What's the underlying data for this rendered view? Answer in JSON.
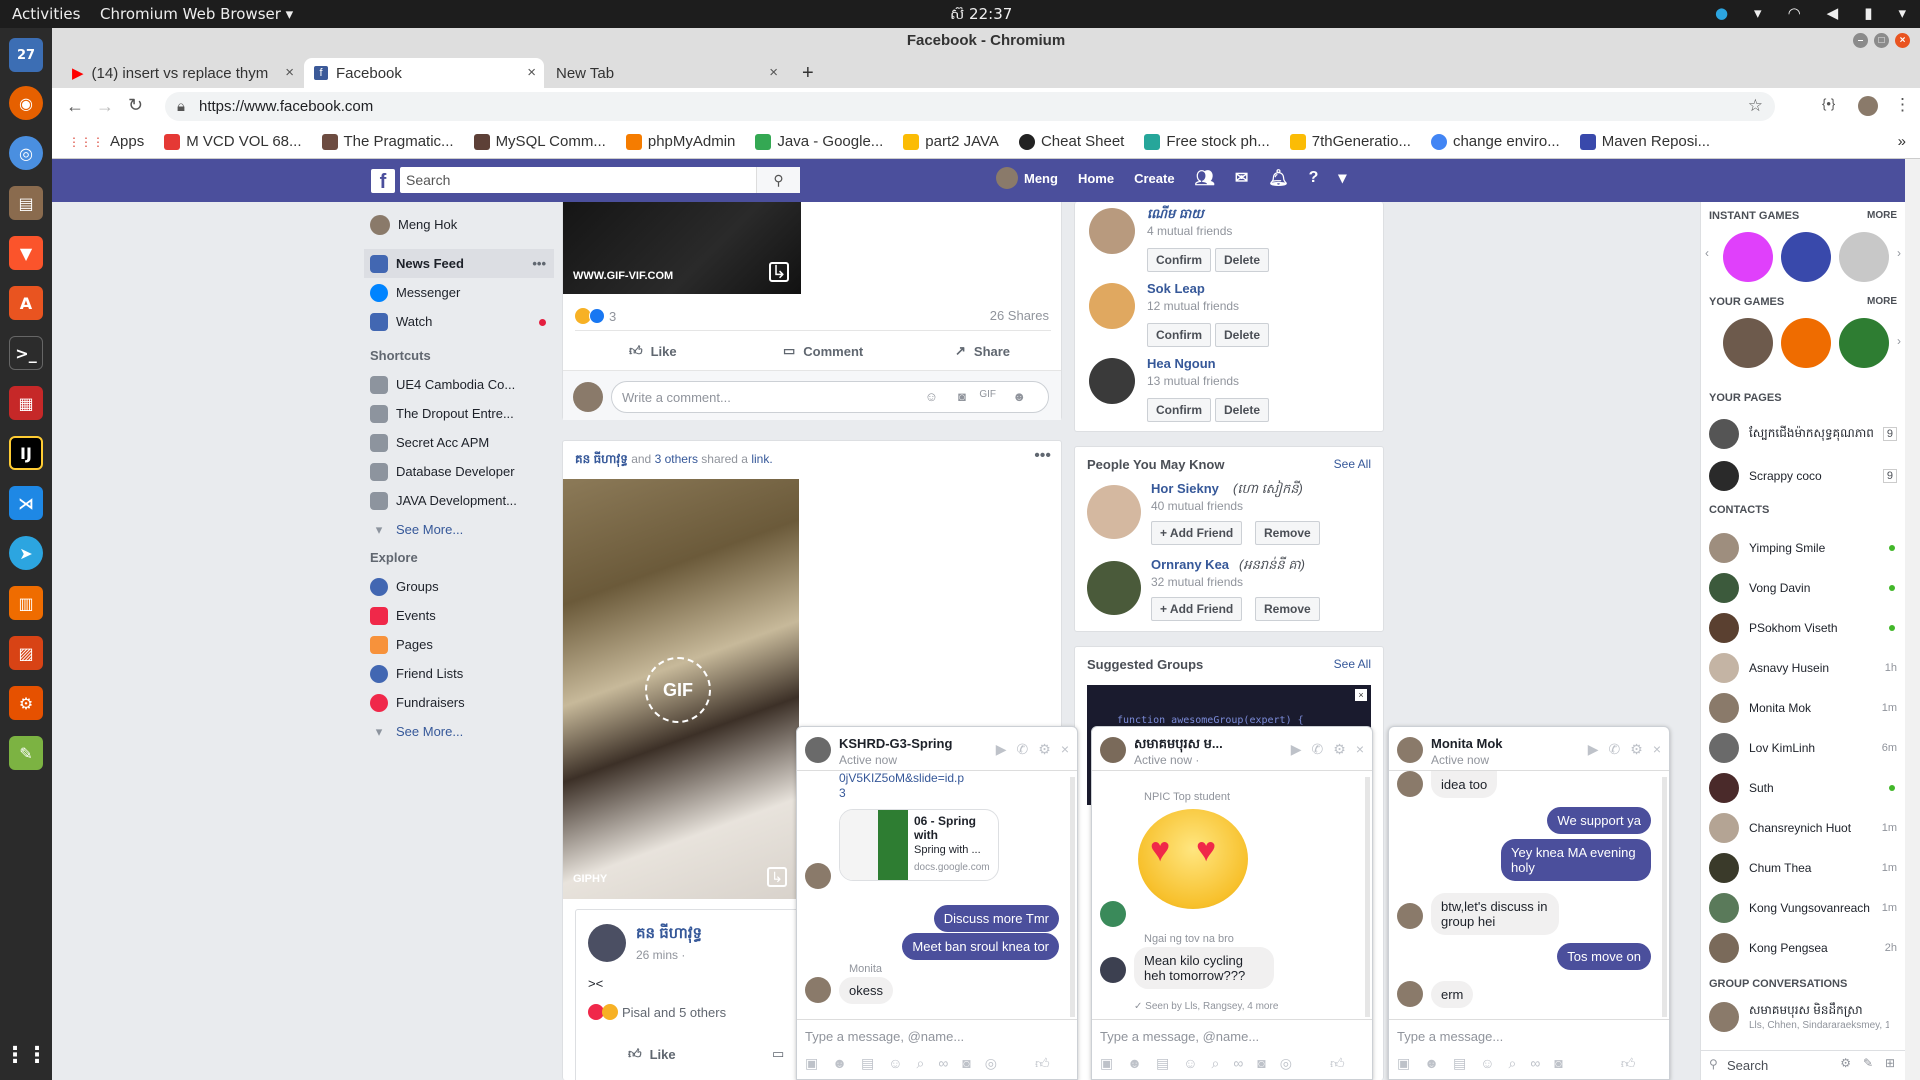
{
  "topbar": {
    "activities": "Activities",
    "app": "Chromium Web Browser ▾",
    "clock": "ស៊ 22:37"
  },
  "dock": {
    "calendar_day": "27"
  },
  "window": {
    "title": "Facebook - Chromium"
  },
  "tabs": [
    {
      "label": "(14) insert vs replace thym",
      "close": "×"
    },
    {
      "label": "Facebook",
      "close": "×"
    },
    {
      "label": "New Tab",
      "close": "×"
    }
  ],
  "new_tab": "+",
  "omnibox": {
    "url": "https://www.facebook.com"
  },
  "bookmarks": [
    {
      "label": "Apps",
      "color": "#db4437"
    },
    {
      "label": "M VCD VOL 68...",
      "color": "#e53935"
    },
    {
      "label": "The Pragmatic...",
      "color": "#6d4c41"
    },
    {
      "label": "MySQL Comm...",
      "color": "#5d4037"
    },
    {
      "label": "phpMyAdmin",
      "color": "#f57c00"
    },
    {
      "label": "Java - Google...",
      "color": "#34a853"
    },
    {
      "label": "part2 JAVA",
      "color": "#fbbc05"
    },
    {
      "label": "Cheat Sheet",
      "color": "#222222"
    },
    {
      "label": "Free stock ph...",
      "color": "#26a69a"
    },
    {
      "label": "7thGeneratio...",
      "color": "#fbbc05"
    },
    {
      "label": "change enviro...",
      "color": "#4285f4"
    },
    {
      "label": "Maven Reposi...",
      "color": "#3949ab"
    }
  ],
  "fb": {
    "logo": "f",
    "search_placeholder": "Search",
    "user": "Meng",
    "home": "Home",
    "create": "Create",
    "brand_color": "#4b4f9c"
  },
  "leftnav": {
    "profile": "Meng Hok",
    "main": [
      {
        "label": "News Feed"
      },
      {
        "label": "Messenger"
      },
      {
        "label": "Watch"
      }
    ],
    "shortcuts_title": "Shortcuts",
    "shortcuts": [
      {
        "label": "UE4 Cambodia Co..."
      },
      {
        "label": "The Dropout Entre..."
      },
      {
        "label": "Secret Acc APM"
      },
      {
        "label": "Database Developer"
      },
      {
        "label": "JAVA Development..."
      }
    ],
    "see_more": "See More...",
    "explore_title": "Explore",
    "explore": [
      {
        "label": "Groups"
      },
      {
        "label": "Events"
      },
      {
        "label": "Pages"
      },
      {
        "label": "Friend Lists"
      },
      {
        "label": "Fundraisers"
      }
    ]
  },
  "post1": {
    "gif_caption": "WWW.GIF-VIF.COM",
    "reactions": "3",
    "shares": "26 Shares",
    "like": "Like",
    "comment": "Comment",
    "share": "Share",
    "comment_placeholder": "Write a comment..."
  },
  "post2": {
    "author": "គន ធីហាវុទ្ធ",
    "and": "and",
    "others": "3 others",
    "shared": "shared a",
    "link": "link.",
    "gif_badge": "GIF",
    "giphy": "GIPHY",
    "inner_author": "គន ធីហាវុទ្ធ",
    "inner_time": "26 mins ·",
    "inner_text": "><",
    "inner_reactions": "Pisal and 5 others",
    "like": "Like"
  },
  "requests": [
    {
      "name": "ណើម ធាយ",
      "mutual": "4 mutual friends",
      "confirm": "Confirm",
      "delete": "Delete"
    },
    {
      "name": "Sok Leap",
      "mutual": "12 mutual friends",
      "confirm": "Confirm",
      "delete": "Delete"
    },
    {
      "name": "Hea Ngoun",
      "mutual": "13 mutual friends",
      "confirm": "Confirm",
      "delete": "Delete"
    }
  ],
  "pymk": {
    "title": "People You May Know",
    "see_all": "See All",
    "people": [
      {
        "name": "Hor Siekny",
        "alt": "(ហោ សៀកនី)",
        "mutual": "40 mutual friends",
        "add": "Add Friend",
        "remove": "Remove"
      },
      {
        "name": "Ornrany Kea",
        "alt": "(អនរាន់នី គា)",
        "mutual": "32 mutual friends",
        "add": "Add Friend",
        "remove": "Remove"
      }
    ]
  },
  "groups": {
    "title": "Suggested Groups",
    "see_all": "See All",
    "code": "function awesomeGroup(expert) {"
  },
  "chatside": {
    "instant_games": "INSTANT GAMES",
    "your_games": "YOUR GAMES",
    "more": "MORE",
    "your_pages": "YOUR PAGES",
    "pages": [
      {
        "label": "ស្បែកជើងម៉ាកសុទ្ធគុណភាព",
        "count": "9"
      },
      {
        "label": "Scrappy coco",
        "count": "9"
      }
    ],
    "contacts_title": "CONTACTS",
    "contacts": [
      {
        "name": "Yimping Smile",
        "status": ""
      },
      {
        "name": "Vong Davin",
        "status": ""
      },
      {
        "name": "PSokhom Viseth",
        "status": ""
      },
      {
        "name": "Asnavy Husein",
        "status": "1h"
      },
      {
        "name": "Monita Mok",
        "status": "1m"
      },
      {
        "name": "Lov KimLinh",
        "status": "6m"
      },
      {
        "name": "Suth",
        "status": ""
      },
      {
        "name": "Chansreynich Huot",
        "status": "1m"
      },
      {
        "name": "Chum Thea",
        "status": "1m"
      },
      {
        "name": "Kong Vungsovanreach",
        "status": "1m"
      },
      {
        "name": "Kong Pengsea",
        "status": "2h"
      }
    ],
    "group_conv_title": "GROUP CONVERSATIONS",
    "group_conv": {
      "name": "សមាគមបុរស មិនដឹកស្រា",
      "members": "Lls, Chhen, Sindararaeksmey, 1..."
    },
    "search": "Search"
  },
  "chats": [
    {
      "title": "KSHRD-G3-Spring",
      "sub": "Active now",
      "link_tail": "0jV5KIZ5oM&slide=id.p3",
      "doc_title": "06 - Spring with",
      "doc_sub": "Spring with ...",
      "doc_domain": "docs.google.com",
      "me1": "Discuss more Tmr",
      "me2": "Meet ban sroul knea tor",
      "them_name": "Monita",
      "them1": "okess",
      "input": "Type a message, @name..."
    },
    {
      "title": "សមាគមបុរស ម...",
      "sub": "Active now ·",
      "sticker_from": "NPIC Top student",
      "them_name": "Ngai ng tov na bro",
      "them1": "Mean kilo cycling heh tomorrow???",
      "seen": "✓ Seen by Lls, Rangsey, 4 more",
      "input": "Type a message, @name..."
    },
    {
      "title": "Monita Mok",
      "sub": "Active now",
      "them0": "idea too",
      "me1": "We support ya",
      "me2": "Yey knea MA evening holy",
      "them1": "btw,let's discuss in group hei",
      "me3": "Tos move on",
      "them2": "erm",
      "input": "Type a message..."
    }
  ]
}
